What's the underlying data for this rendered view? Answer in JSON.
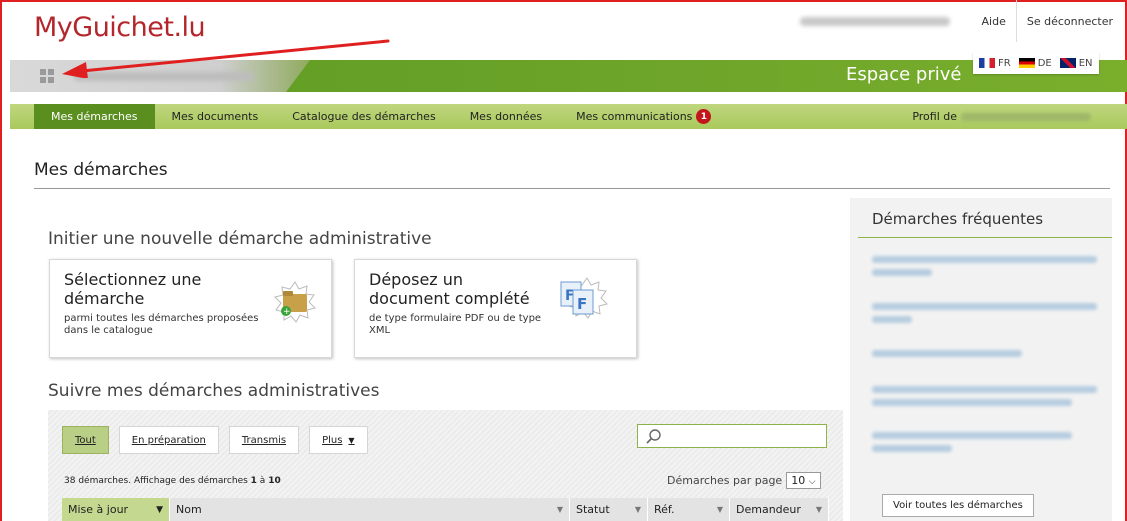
{
  "header": {
    "logo": "MyGuichet.lu",
    "help": "Aide",
    "logout": "Se déconnecter",
    "space_title": "Espace privé",
    "languages": [
      {
        "code": "FR",
        "flag": "flag-fr-icon"
      },
      {
        "code": "DE",
        "flag": "flag-de-icon"
      },
      {
        "code": "EN",
        "flag": "flag-en-icon"
      }
    ]
  },
  "nav": {
    "items": [
      "Mes démarches",
      "Mes documents",
      "Catalogue des démarches",
      "Mes données",
      "Mes communications"
    ],
    "notification_count": "1",
    "profile_label": "Profil de"
  },
  "main": {
    "title": "Mes démarches",
    "initiate_heading": "Initier une nouvelle démarche administrative",
    "card_select": {
      "title_line1": "Sélectionnez une",
      "title_line2": "démarche",
      "desc_line1": "parmi toutes les démarches proposées",
      "desc_line2": "dans le catalogue"
    },
    "card_upload": {
      "title_line1": "Déposez un",
      "title_line2": "document complété",
      "desc_line1": "de type formulaire PDF ou de type",
      "desc_line2": "XML"
    },
    "follow_heading": "Suivre mes démarches administratives",
    "filters": [
      "Tout",
      "En préparation",
      "Transmis",
      "Plus"
    ],
    "count_prefix": "38 démarches. Affichage des démarches ",
    "count_from": "1",
    "count_sep": " à ",
    "count_to": "10",
    "per_page_label": "Démarches par page",
    "per_page_value": "10",
    "columns": [
      "Mise à jour",
      "Nom",
      "Statut",
      "Réf.",
      "Demandeur"
    ]
  },
  "sidebar": {
    "title": "Démarches fréquentes",
    "button": "Voir toutes les démarches"
  },
  "colors": {
    "brand_red": "#b3262b",
    "green": "#6ea52a",
    "badge": "#c2151c",
    "annotation_arrow": "#e02020"
  }
}
